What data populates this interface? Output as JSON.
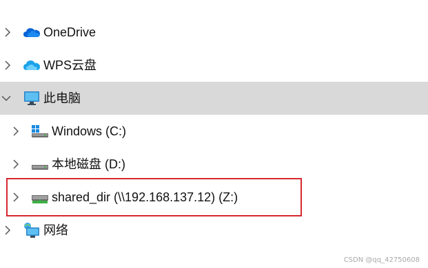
{
  "tree": {
    "items": [
      {
        "label": "OneDrive",
        "icon": "onedrive-cloud-icon",
        "expanded": false
      },
      {
        "label": "WPS云盘",
        "icon": "wps-cloud-icon",
        "expanded": false
      },
      {
        "label": "此电脑",
        "icon": "monitor-icon",
        "expanded": true,
        "selected": true
      },
      {
        "label": "Windows (C:)",
        "icon": "windows-drive-icon",
        "expanded": false
      },
      {
        "label": "本地磁盘 (D:)",
        "icon": "local-disk-icon",
        "expanded": false
      },
      {
        "label": "shared_dir (\\\\192.168.137.12) (Z:)",
        "icon": "network-drive-icon",
        "expanded": false,
        "highlighted": true
      },
      {
        "label": "网络",
        "icon": "network-icon",
        "expanded": false
      }
    ]
  },
  "colors": {
    "selected_background": "#d9d9d9",
    "highlight_border": "#d6272f",
    "onedrive_blue": "#0a64d6",
    "wps_blue": "#1aa3e8",
    "drive_green": "#3cb043"
  },
  "watermark": "CSDN @qq_42750608"
}
